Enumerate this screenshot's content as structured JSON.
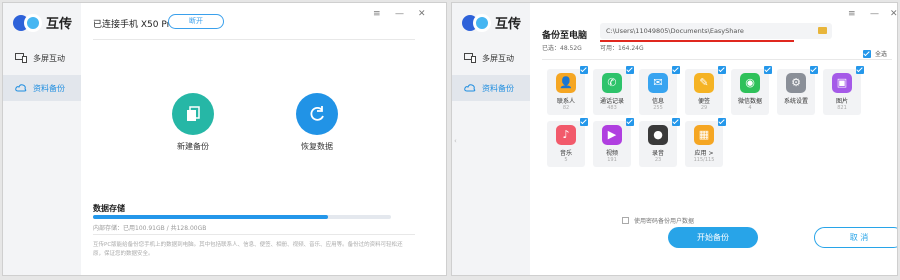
{
  "window1": {
    "app_name": "互传",
    "nav": [
      {
        "label": "多屏互动",
        "icon": "screens-icon"
      },
      {
        "label": "资料备份",
        "icon": "cloud-sync-icon"
      }
    ],
    "window_controls": [
      "≡",
      "—",
      "✕"
    ],
    "device": "已连接手机 X50 Pro",
    "disconnect_label": "断开",
    "actions": [
      {
        "label": "新建备份",
        "icon": "copy-icon",
        "color": "#26b7a6"
      },
      {
        "label": "恢复数据",
        "icon": "refresh-icon",
        "color": "#2193e6"
      }
    ],
    "storage": {
      "title": "数据存储",
      "used_fraction": 0.79,
      "info": "内部存储：已用100.91GB / 共128.00GB"
    },
    "note": "互传PC版能给备份您手机上的数据到电脑。其中包括联系人、信息、便签、相册、视频、音乐、应用等。备份过的资料可轻松还原，保证您的数据安全。"
  },
  "window2": {
    "app_name": "互传",
    "nav": [
      {
        "label": "多屏互动",
        "icon": "screens-icon"
      },
      {
        "label": "资料备份",
        "icon": "cloud-sync-icon"
      }
    ],
    "window_controls": [
      "≡",
      "—",
      "✕"
    ],
    "backup_title": "备份至电脑",
    "path": "C:\\Users\\11049805\\Documents\\EasyShare",
    "used_label": "已选：48.52G",
    "free_label": "可用：164.24G",
    "select_all": "全选",
    "items": [
      {
        "name": "联系人",
        "count": "82",
        "color": "#f5a623",
        "icon": "contacts-icon"
      },
      {
        "name": "通话记录",
        "count": "483",
        "color": "#2ec36b",
        "icon": "phone-icon"
      },
      {
        "name": "信息",
        "count": "255",
        "color": "#38a4f0",
        "icon": "message-icon"
      },
      {
        "name": "便签",
        "count": "29",
        "color": "#f5b324",
        "icon": "note-icon"
      },
      {
        "name": "微信数据",
        "count": "4",
        "color": "#2fc15a",
        "icon": "wechat-icon"
      },
      {
        "name": "系统设置",
        "count": "",
        "color": "#8a8f98",
        "icon": "settings-icon"
      },
      {
        "name": "图片",
        "count": "821",
        "color": "#a55ae8",
        "icon": "image-icon"
      },
      {
        "name": "音乐",
        "count": "5",
        "color": "#f25a6b",
        "icon": "music-icon"
      },
      {
        "name": "视频",
        "count": "191",
        "color": "#b03fe0",
        "icon": "video-icon"
      },
      {
        "name": "录音",
        "count": "23",
        "color": "#3a3a3a",
        "icon": "record-icon"
      },
      {
        "name": "应用 >",
        "count": "115/115",
        "color": "#f5a623",
        "icon": "apps-icon"
      }
    ],
    "password_option": "使用密码备份用户数据",
    "start_label": "开始备份",
    "cancel_label": "取 消"
  }
}
